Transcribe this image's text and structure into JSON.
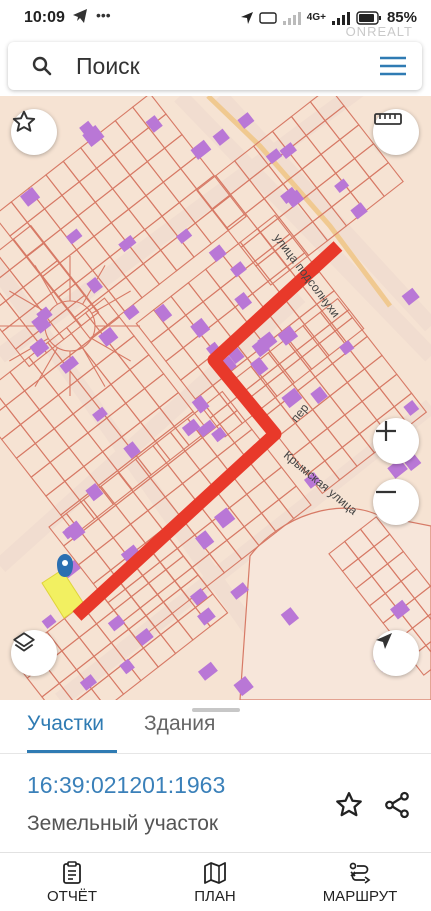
{
  "status_bar": {
    "time": "10:09",
    "battery": "85%",
    "network": "4G+",
    "watermark": "ONREALT"
  },
  "search": {
    "placeholder": "Поиск"
  },
  "map": {
    "street_1": "улица подсолнухи",
    "street_2": "Крымская улица",
    "street_3": "Ве",
    "street_4": "пер",
    "route_color": "#e8392a",
    "parcel_stroke": "#d77a66",
    "building_color": "#b977d6",
    "selected_parcel_color": "#f2f061"
  },
  "tabs": {
    "active": "Участки",
    "inactive": "Здания"
  },
  "parcel": {
    "cadastral_number": "16:39:021201:1963",
    "type": "Земельный участок"
  },
  "bottom_nav": {
    "report": "ОТЧЁТ",
    "plan": "ПЛАН",
    "route": "МАРШРУТ"
  }
}
